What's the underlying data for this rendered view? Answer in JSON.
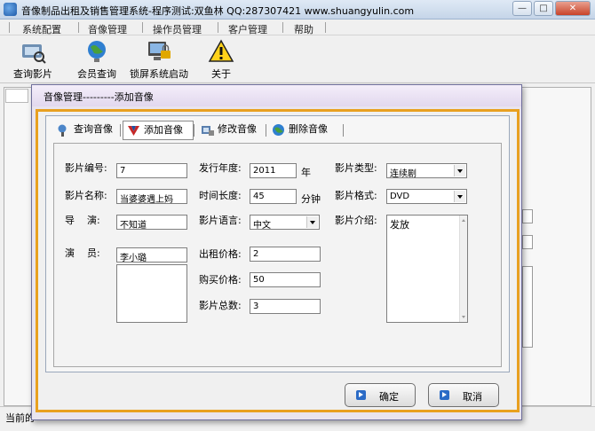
{
  "window": {
    "title": "音像制品出租及销售管理系统-程序测试:双鱼林 QQ:287307421 www.shuangyulin.com",
    "caption_buttons": [
      "—",
      "□",
      "✕"
    ]
  },
  "menubar": [
    "系统配置",
    "音像管理",
    "操作员管理",
    "客户管理",
    "帮助"
  ],
  "toolbar": [
    {
      "label": "查询影片",
      "icon": "query-film-icon"
    },
    {
      "label": "会员查询",
      "icon": "globe-icon"
    },
    {
      "label": "锁屏系统启动",
      "icon": "lock-screen-icon"
    },
    {
      "label": "关于",
      "icon": "warning-icon"
    }
  ],
  "statusbar": {
    "text": "当前的"
  },
  "dialog": {
    "title": "音像管理---------添加音像",
    "tabs": [
      {
        "label": "查询音像",
        "icon": "query-icon",
        "active": false
      },
      {
        "label": "添加音像",
        "icon": "add-icon",
        "active": true
      },
      {
        "label": "修改音像",
        "icon": "edit-icon",
        "active": false
      },
      {
        "label": "删除音像",
        "icon": "delete-icon",
        "active": false
      }
    ],
    "form": {
      "film_no": {
        "label": "影片编号:",
        "value": "7"
      },
      "film_name": {
        "label": "影片名称:",
        "value": "当婆婆遇上妈"
      },
      "director": {
        "label": "导    演:",
        "value": "不知道"
      },
      "actor": {
        "label": "演    员:",
        "value": "李小璐"
      },
      "year": {
        "label": "发行年度:",
        "value": "2011",
        "unit": "年"
      },
      "length": {
        "label": "时间长度:",
        "value": "45",
        "unit": "分钟"
      },
      "language": {
        "label": "影片语言:",
        "value": "中文"
      },
      "rent_price": {
        "label": "出租价格:",
        "value": "2"
      },
      "buy_price": {
        "label": "购买价格:",
        "value": "50"
      },
      "total": {
        "label": "影片总数:",
        "value": "3"
      },
      "type": {
        "label": "影片类型:",
        "value": "连续剧"
      },
      "format": {
        "label": "影片格式:",
        "value": "DVD"
      },
      "intro": {
        "label": "影片介绍:",
        "value": "发放"
      }
    },
    "buttons": {
      "ok": "确定",
      "cancel": "取消"
    }
  },
  "colors": {
    "dialog_frame": "#e8a020",
    "button_icon": "#2b6bc6"
  }
}
